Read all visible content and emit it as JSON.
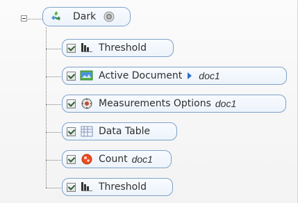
{
  "tree": {
    "root": {
      "label": "Dark",
      "icon": "recycle-icon",
      "trailing_icon": "camera-lens-icon"
    },
    "items": [
      {
        "label": "Threshold",
        "icon": "threshold-icon"
      },
      {
        "label": "Active Document",
        "icon": "active-document-icon",
        "pointer_icon": "chevron-right-icon",
        "doc": "doc1"
      },
      {
        "label": "Measurements Options",
        "icon": "settings-gear-icon",
        "doc": "doc1"
      },
      {
        "label": "Data Table",
        "icon": "table-icon"
      },
      {
        "label": "Count",
        "icon": "count-icon",
        "doc": "doc1"
      },
      {
        "label": "Threshold",
        "icon": "threshold-icon"
      }
    ]
  }
}
